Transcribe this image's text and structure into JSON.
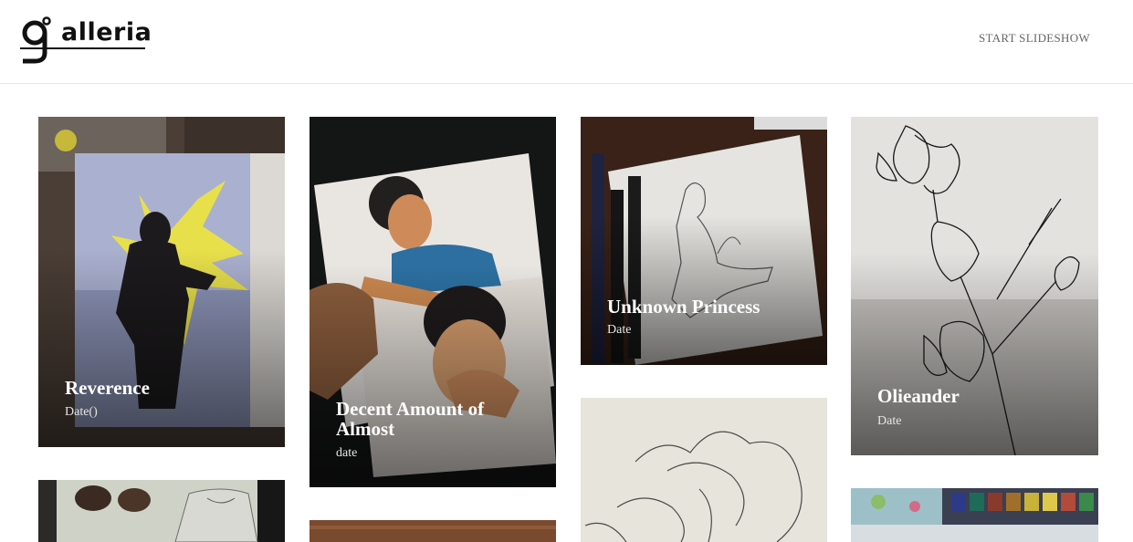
{
  "header": {
    "logo_text": "alleria",
    "slideshow_label": "START SLIDESHOW"
  },
  "gallery": {
    "items": [
      {
        "title": "Reverence",
        "date": "Date()"
      },
      {
        "title": "Decent Amount of Almost",
        "date": "date"
      },
      {
        "title": "Unknown Princess",
        "date": "Date"
      },
      {
        "title": "Olieander",
        "date": "Date"
      },
      {
        "title": "",
        "date": ""
      },
      {
        "title": "",
        "date": ""
      },
      {
        "title": "",
        "date": ""
      },
      {
        "title": "",
        "date": ""
      }
    ]
  },
  "colors": {
    "header_border": "#e6e6e6",
    "nav_text": "#666666",
    "title_text": "#ffffff"
  }
}
